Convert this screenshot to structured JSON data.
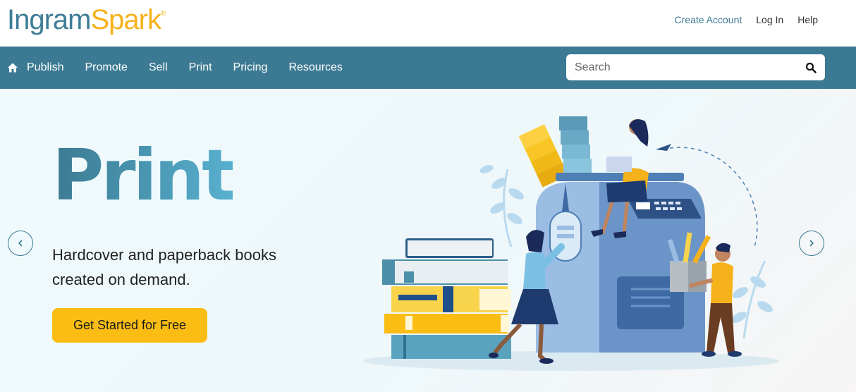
{
  "brand": {
    "part1": "Ingram",
    "part2": "Spark",
    "reg": "®"
  },
  "toplinks": {
    "create_account": "Create Account",
    "login": "Log In",
    "help": "Help"
  },
  "nav": {
    "items": [
      {
        "label": "Publish"
      },
      {
        "label": "Promote"
      },
      {
        "label": "Sell"
      },
      {
        "label": "Print"
      },
      {
        "label": "Pricing"
      },
      {
        "label": "Resources"
      }
    ],
    "home_icon": "home-icon"
  },
  "search": {
    "placeholder": "Search",
    "icon": "search-icon"
  },
  "hero": {
    "title": "Print",
    "subtitle": "Hardcover and paperback books created on demand.",
    "cta": "Get Started for Free",
    "prev_icon": "chevron-left-icon",
    "next_icon": "chevron-right-icon"
  },
  "colors": {
    "brand_blue": "#3b7a92",
    "brand_yellow": "#fbbd14"
  }
}
